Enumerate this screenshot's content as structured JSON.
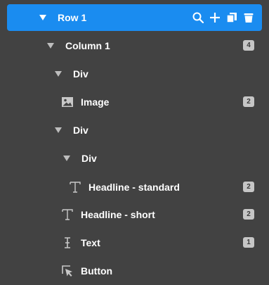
{
  "tree": {
    "row1": {
      "label": "Row 1"
    },
    "column1": {
      "label": "Column 1",
      "count": "4"
    },
    "div1": {
      "label": "Div"
    },
    "image": {
      "label": "Image",
      "count": "2"
    },
    "div2": {
      "label": "Div"
    },
    "div3": {
      "label": "Div"
    },
    "headline_standard": {
      "label": "Headline - standard",
      "count": "2"
    },
    "headline_short": {
      "label": "Headline - short",
      "count": "2"
    },
    "text": {
      "label": "Text",
      "count": "1"
    },
    "button": {
      "label": "Button"
    }
  },
  "colors": {
    "background": "#424242",
    "selected": "#1a8cf0",
    "badge": "#c6c6c6"
  },
  "icons": {
    "row_actions": [
      "search-icon",
      "plus-icon",
      "copy-icon",
      "trash-icon"
    ],
    "image": "image-icon",
    "headline": "headline-t-icon",
    "text": "text-cursor-icon",
    "button": "cursor-select-icon"
  }
}
